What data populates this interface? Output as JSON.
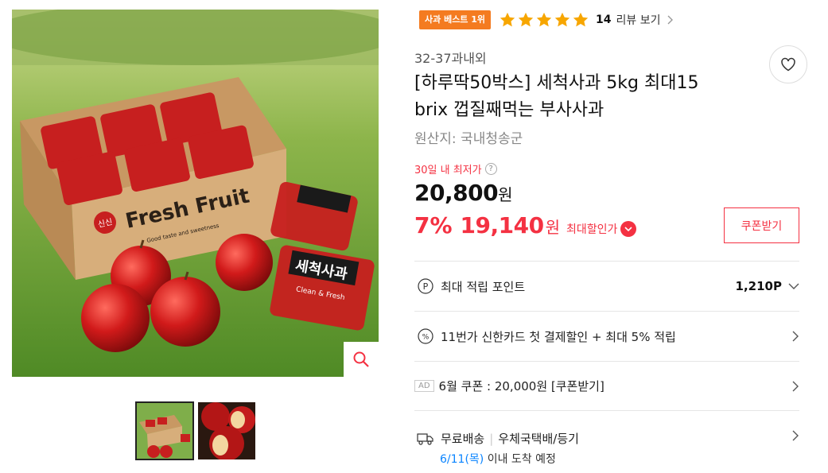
{
  "image": {
    "box_brand": "신신",
    "box_text": "Fresh Fruit",
    "box_slogan": "Good taste and sweetness",
    "pack_label": "세척사과",
    "pack_sub": "Clean & Fresh"
  },
  "badge": {
    "label": "사과 베스트 1위"
  },
  "rating": {
    "stars": 5,
    "count": "14",
    "label": "리뷰 보기"
  },
  "product": {
    "seller": "32-37과내외",
    "title_line1": "[하루딱50박스] 세척사과 5kg 최대15",
    "title_line2": "brix 껍질째먹는 부사사과",
    "origin": "원산지: 국내청송군"
  },
  "price": {
    "lowest_label": "30일 내 최저가",
    "original": "20,800",
    "original_unit": "원",
    "sale_rate": "7%",
    "sale_price": "19,140",
    "sale_unit": "원",
    "max_discount_label": "최대할인가"
  },
  "coupon_button": "쿠폰받기",
  "rows": {
    "points_label": "최대 적립 포인트",
    "points_value": "1,210P",
    "card_label": "11번가 신한카드 첫 결제할인 + 최대 5% 적립",
    "ad_badge": "AD",
    "ad_coupon": "6월 쿠폰 : 20,000원 [쿠폰받기]",
    "ship_free": "무료배송",
    "ship_carrier": "우체국택배/등기",
    "ship_date": "6/11(목)",
    "ship_suffix": "이내 도착 예정"
  },
  "colors": {
    "accent": "#f43142",
    "badge": "#f47b20",
    "star": "#f7a600",
    "link": "#0a84ff"
  }
}
